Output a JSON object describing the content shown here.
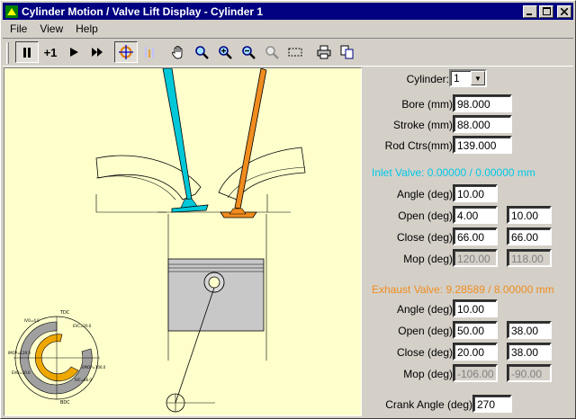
{
  "window": {
    "title": "Cylinder Motion / Valve Lift Display - Cylinder 1"
  },
  "menu": {
    "file": "File",
    "view": "View",
    "help": "Help"
  },
  "toolbar": {
    "step_label": "+1"
  },
  "panel": {
    "cylinder_label": "Cylinder:",
    "cylinder_value": "1",
    "bore_label": "Bore (mm)",
    "bore_value": "98.000",
    "stroke_label": "Stroke (mm)",
    "stroke_value": "88.000",
    "rod_label": "Rod Ctrs(mm)",
    "rod_value": "139.000",
    "inlet": {
      "header": "Inlet Valve: 0.00000 / 0.00000 mm",
      "color": "#00c8e8",
      "angle_label": "Angle (deg)",
      "angle_value": "10.00",
      "open_label": "Open (deg)",
      "open_a": "4.00",
      "open_b": "10.00",
      "close_label": "Close (deg)",
      "close_a": "66.00",
      "close_b": "66.00",
      "mop_label": "Mop (deg)",
      "mop_a": "120.00",
      "mop_b": "118.00"
    },
    "exhaust": {
      "header": "Exhaust Valve: 9.28589 / 8.00000 mm",
      "color": "#f08c1e",
      "angle_label": "Angle (deg)",
      "angle_value": "10.00",
      "open_label": "Open (deg)",
      "open_a": "50.00",
      "open_b": "38.00",
      "close_label": "Close (deg)",
      "close_a": "20.00",
      "close_b": "38.00",
      "mop_label": "Mop (deg)",
      "mop_a": "-106.00",
      "mop_b": "-90.00"
    },
    "crank_label": "Crank Angle (deg)",
    "crank_value": "270"
  },
  "diagram": {
    "tdc": "TDC",
    "bdc": "BDC"
  }
}
